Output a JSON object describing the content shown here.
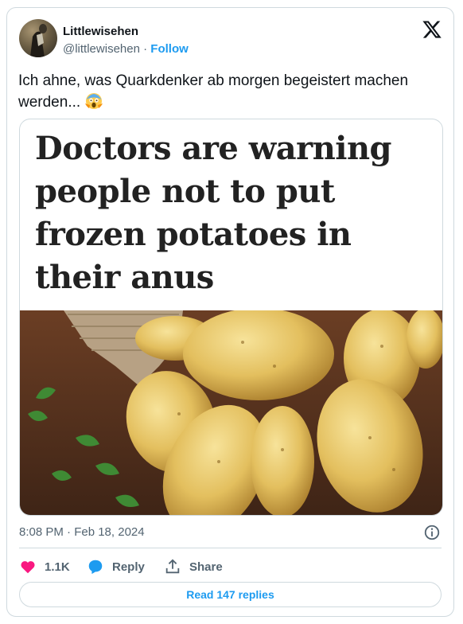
{
  "author": {
    "display_name": "Littlewisehen",
    "handle": "@littlewisehen",
    "separator": " · ",
    "follow_label": "Follow"
  },
  "tweet": {
    "text": "Ich ahne, was Quarkdenker ab morgen begeistert machen werden... ",
    "emoji": "😱"
  },
  "media": {
    "headline": "Doctors are warning people not to put frozen potatoes in their anus"
  },
  "timestamp": "8:08 PM · Feb 18, 2024",
  "actions": {
    "likes": "1.1K",
    "reply_label": "Reply",
    "share_label": "Share"
  },
  "replies_button": "Read 147 replies",
  "colors": {
    "accent": "#1d9bf0",
    "like": "#f91880",
    "text_secondary": "#536471",
    "border": "#cfd9de"
  }
}
